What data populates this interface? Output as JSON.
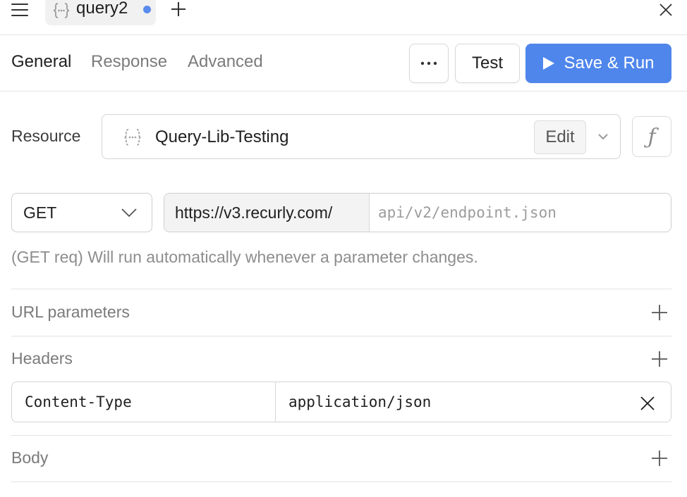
{
  "tabbar": {
    "tab_title": "query2",
    "tab_unsaved_color": "#5a8bee",
    "icons": {
      "menu": "hamburger-icon",
      "tab": "code-braces-icon",
      "new_tab": "plus-icon",
      "close": "close-icon"
    }
  },
  "toolbar": {
    "tabs": [
      {
        "label": "General",
        "active": true
      },
      {
        "label": "Response",
        "active": false
      },
      {
        "label": "Advanced",
        "active": false
      }
    ],
    "more_icon": "ellipsis-icon",
    "test_label": "Test",
    "run_label": "Save & Run",
    "accent_color": "#4f86ec"
  },
  "resource": {
    "label": "Resource",
    "name": "Query-Lib-Testing",
    "edit_label": "Edit",
    "fx_label": "ƒ"
  },
  "request": {
    "method": "GET",
    "base_url": "https://v3.recurly.com/",
    "path_placeholder": "api/v2/endpoint.json",
    "hint": "(GET req) Will run automatically whenever a parameter changes."
  },
  "sections": {
    "url_params": "URL parameters",
    "headers": "Headers",
    "body": "Body"
  },
  "headers": [
    {
      "key": "Content-Type",
      "value": "application/json"
    }
  ]
}
